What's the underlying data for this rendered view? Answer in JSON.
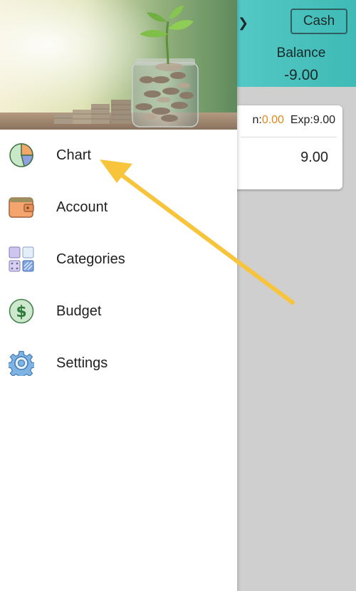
{
  "background": {
    "cash_button_label": "Cash",
    "balance_label": "Balance",
    "balance_value": "-9.00",
    "card": {
      "income_label": "n:",
      "income_value": "0.00",
      "expense_label": "Exp:",
      "expense_value": "9.00",
      "amount": "9.00"
    }
  },
  "drawer": {
    "menu": [
      {
        "label": "Chart",
        "icon": "pie-chart-icon"
      },
      {
        "label": "Account",
        "icon": "wallet-icon"
      },
      {
        "label": "Categories",
        "icon": "grid-icon"
      },
      {
        "label": "Budget",
        "icon": "dollar-icon"
      },
      {
        "label": "Settings",
        "icon": "gear-icon"
      }
    ]
  },
  "colors": {
    "header_teal": "#55c7c4",
    "income_orange": "#e08a1e",
    "arrow_yellow": "#f7c43c"
  }
}
